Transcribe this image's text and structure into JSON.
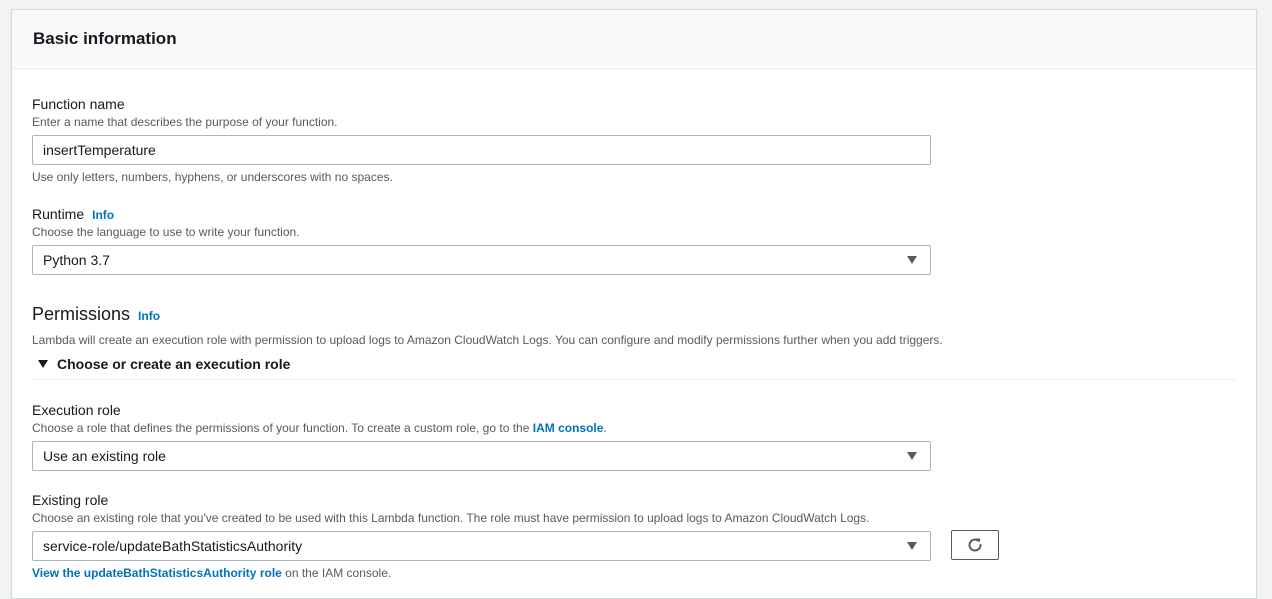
{
  "panel": {
    "title": "Basic information"
  },
  "function_name": {
    "label": "Function name",
    "description": "Enter a name that describes the purpose of your function.",
    "value": "insertTemperature",
    "constraint": "Use only letters, numbers, hyphens, or underscores with no spaces."
  },
  "runtime": {
    "label": "Runtime",
    "info": "Info",
    "description": "Choose the language to use to write your function.",
    "selected": "Python 3.7"
  },
  "permissions": {
    "title": "Permissions",
    "info": "Info",
    "description": "Lambda will create an execution role with permission to upload logs to Amazon CloudWatch Logs. You can configure and modify permissions further when you add triggers.",
    "expander_label": "Choose or create an execution role",
    "expanded": true
  },
  "execution_role": {
    "label": "Execution role",
    "description_prefix": "Choose a role that defines the permissions of your function. To create a custom role, go to the ",
    "description_link": "IAM console",
    "description_suffix": ".",
    "selected": "Use an existing role"
  },
  "existing_role": {
    "label": "Existing role",
    "description": "Choose an existing role that you've created to be used with this Lambda function. The role must have permission to upload logs to Amazon CloudWatch Logs.",
    "selected": "service-role/updateBathStatisticsAuthority",
    "view_link": "View the updateBathStatisticsAuthority role",
    "view_suffix": " on the IAM console."
  },
  "icons": {
    "refresh": "refresh-icon",
    "dropdown": "caret-down-icon",
    "expander": "caret-down-icon"
  },
  "colors": {
    "link": "#0073bb",
    "panel_header_bg": "#fafafa",
    "border": "#aab7b8"
  }
}
